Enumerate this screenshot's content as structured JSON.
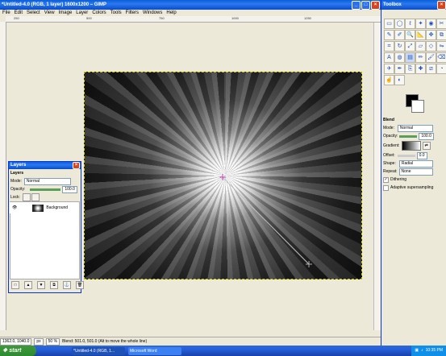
{
  "main_window": {
    "title": "*Untitled-4.0 (RGB, 1 layer) 1600x1200 – GIMP"
  },
  "menu": [
    "File",
    "Edit",
    "Select",
    "View",
    "Image",
    "Layer",
    "Colors",
    "Tools",
    "Filters",
    "Windows",
    "Help"
  ],
  "ruler": {
    "ticks": [
      "250",
      "500",
      "750",
      "1000",
      "1250"
    ]
  },
  "statusbar": {
    "coords": "1362.0, 1040.0",
    "unit": "px",
    "zoom": "50 %",
    "message": "Blend: 501.0, 501.0 (Alt to move the whole line)"
  },
  "toolbox": {
    "title": "Toolbox",
    "tools": [
      "rect-select",
      "ellipse-select",
      "free-select",
      "fuzzy-select",
      "select-by-color",
      "scissors",
      "paths",
      "color-picker",
      "zoom",
      "measure",
      "move",
      "align",
      "crop",
      "rotate",
      "scale",
      "shear",
      "perspective",
      "flip",
      "text",
      "bucket-fill",
      "blend",
      "pencil",
      "paintbrush",
      "eraser",
      "airbrush",
      "ink",
      "clone",
      "heal",
      "perspective-clone",
      "blur",
      "smudge",
      "dodge"
    ],
    "tool_glyphs": [
      "▭",
      "◯",
      "ℓ",
      "✦",
      "◉",
      "✂",
      "✎",
      "✐",
      "🔍",
      "📐",
      "✥",
      "⧉",
      "⌗",
      "↻",
      "⤢",
      "▱",
      "◇",
      "⇋",
      "A",
      "◍",
      "▤",
      "✏",
      "🖌",
      "⌫",
      "✈",
      "✒",
      "⎘",
      "✚",
      "⧄",
      "◔",
      "☝",
      "◐"
    ],
    "blend": {
      "title": "Blend",
      "mode_label": "Mode:",
      "mode_value": "Normal",
      "opacity_label": "Opacity:",
      "opacity_value": "100.0",
      "gradient_label": "Gradient:",
      "offset_label": "Offset:",
      "offset_value": "0.0",
      "shape_label": "Shape:",
      "shape_value": "Radial",
      "repeat_label": "Repeat:",
      "repeat_value": "None",
      "dithering_label": "Dithering",
      "adaptive_label": "Adaptive supersampling"
    }
  },
  "layers": {
    "title": "Layers",
    "heading": "Layers",
    "mode_label": "Mode:",
    "mode_value": "Normal",
    "opacity_label": "Opacity:",
    "opacity_value": "100.0",
    "lock_label": "Lock:",
    "layer_name": "Background"
  },
  "taskbar": {
    "start": "start",
    "tasks": [
      "*Untitled-4.0 (RGB, 1...",
      "Microsoft Word"
    ],
    "clock": "10:35 PM"
  }
}
